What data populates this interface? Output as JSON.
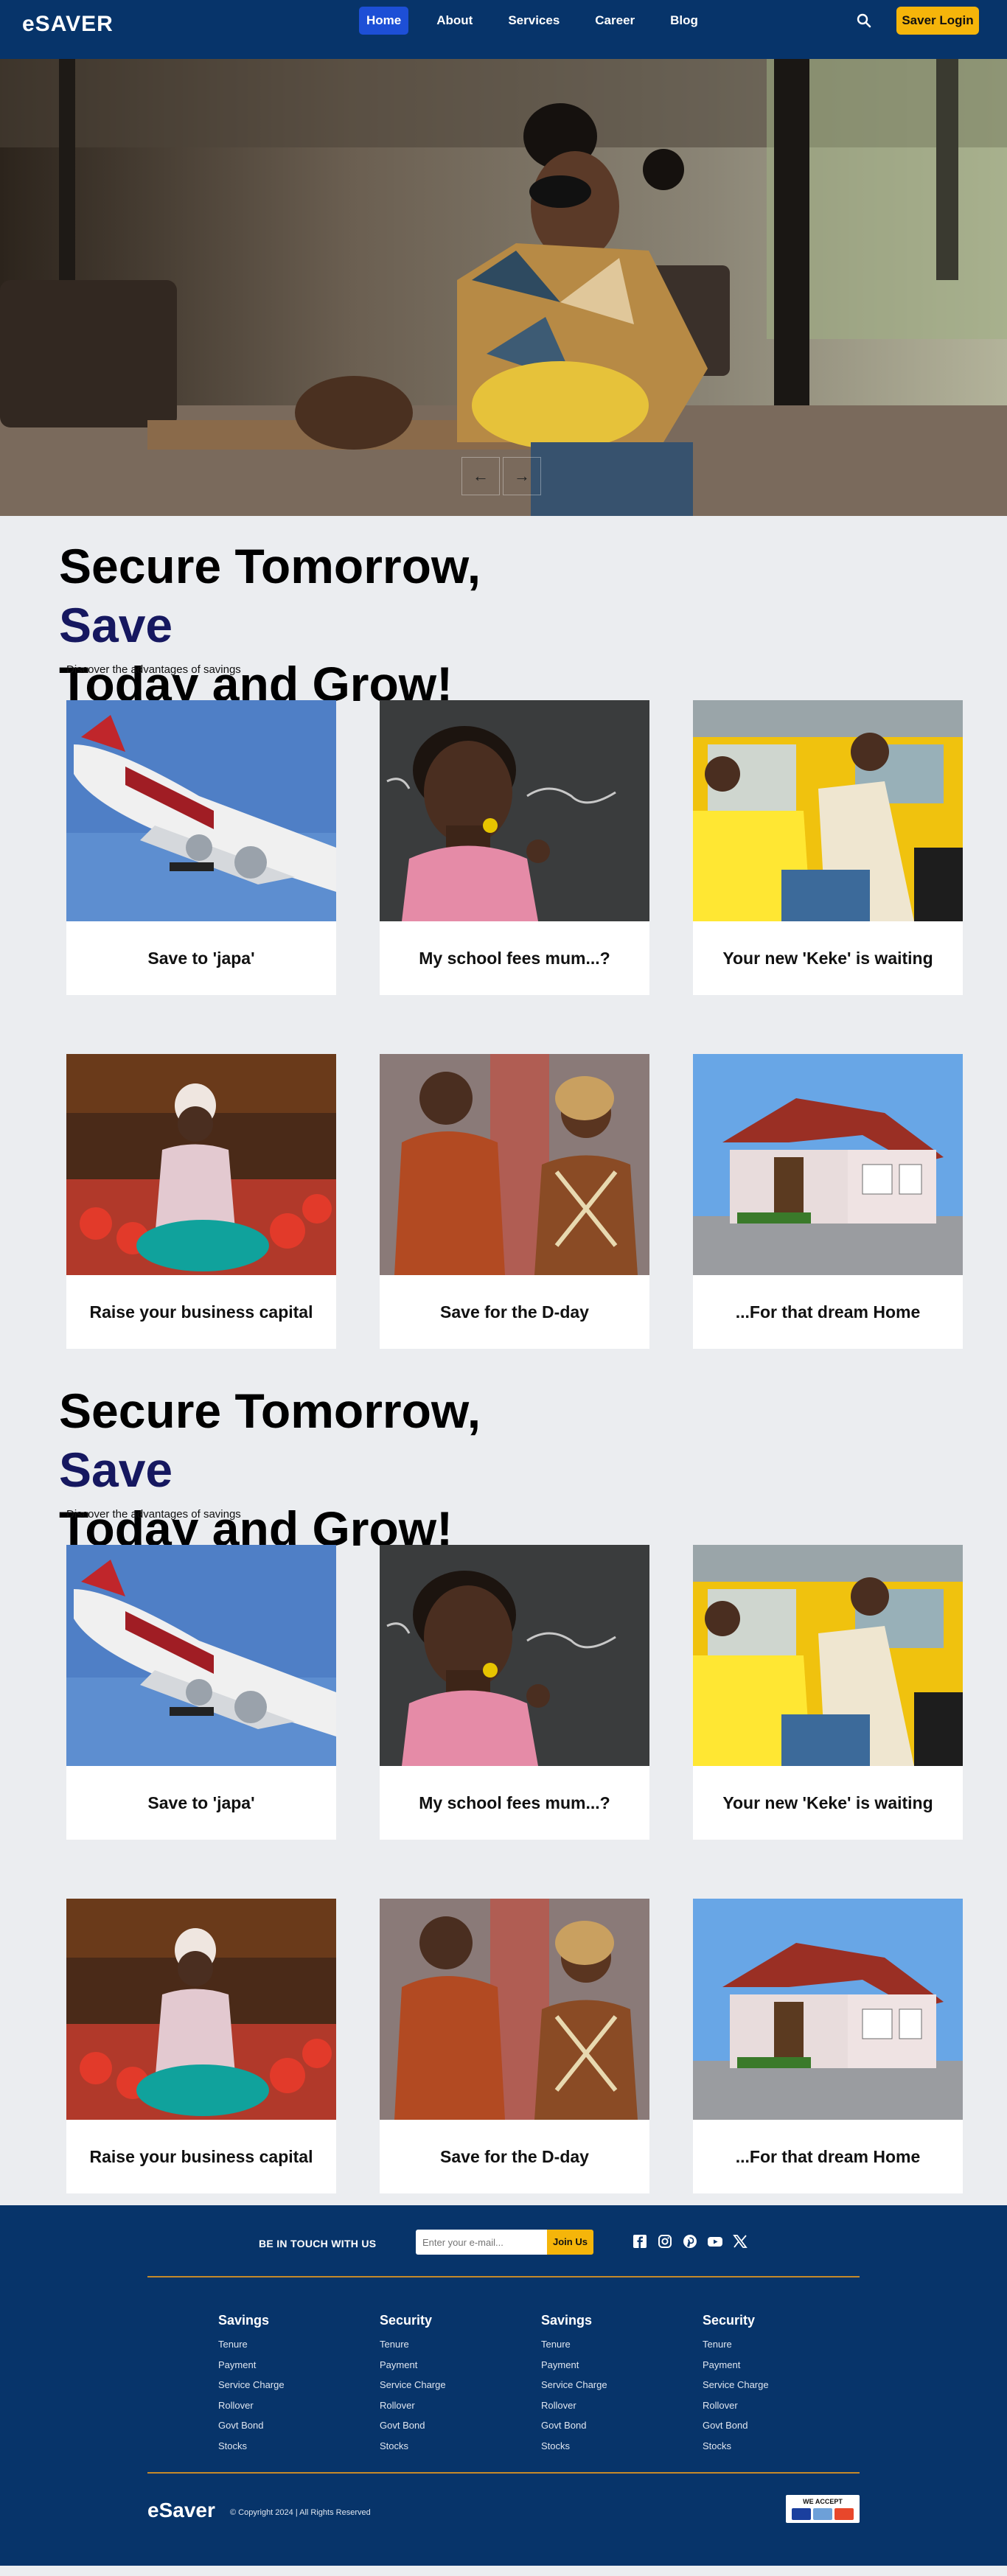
{
  "nav": {
    "logo": "eSAVER",
    "items": [
      {
        "label": "Home",
        "active": true
      },
      {
        "label": "About",
        "active": false
      },
      {
        "label": "Services",
        "active": false
      },
      {
        "label": "Career",
        "active": false
      },
      {
        "label": "Blog",
        "active": false
      }
    ],
    "search_icon": "search-icon",
    "login_label": "Saver Login"
  },
  "hero": {
    "prev_icon": "arrow-left-icon",
    "next_icon": "arrow-right-icon",
    "prev_glyph": "←",
    "next_glyph": "→"
  },
  "sections": [
    {
      "title_start": "Secure Tomorrow, ",
      "title_accent": "Save",
      "title_end": "Today and Grow!",
      "subtitle": "Discover the advantages of savings",
      "cards": [
        {
          "caption": "Save to 'japa'",
          "image": "airplane"
        },
        {
          "caption": "My school fees mum...?",
          "image": "schoolgirl"
        },
        {
          "caption": "Your new 'Keke' is waiting",
          "image": "keke"
        },
        {
          "caption": "Raise your business capital",
          "image": "market"
        },
        {
          "caption": "Save for the D-day",
          "image": "wedding"
        },
        {
          "caption": "...For that dream Home",
          "image": "house"
        }
      ]
    },
    {
      "title_start": "Secure Tomorrow, ",
      "title_accent": "Save",
      "title_end": "Today and Grow!",
      "subtitle": "Discover the advantages of savings",
      "cards": [
        {
          "caption": "Save to 'japa'",
          "image": "airplane"
        },
        {
          "caption": "My school fees mum...?",
          "image": "schoolgirl"
        },
        {
          "caption": "Your new 'Keke' is waiting",
          "image": "keke"
        },
        {
          "caption": "Raise your business capital",
          "image": "market"
        },
        {
          "caption": "Save for the D-day",
          "image": "wedding"
        },
        {
          "caption": "...For that dream Home",
          "image": "house"
        }
      ]
    }
  ],
  "footer": {
    "touch_title": "BE IN TOUCH WITH US",
    "email_placeholder": "Enter your e-mail...",
    "join_label": "Join Us",
    "socials": [
      "facebook-icon",
      "instagram-icon",
      "pinterest-icon",
      "youtube-icon",
      "x-icon"
    ],
    "columns": [
      {
        "heading": "Savings",
        "links": [
          "Tenure",
          "Payment",
          "Service Charge",
          "Rollover",
          "Govt Bond",
          "Stocks"
        ]
      },
      {
        "heading": "Security",
        "links": [
          "Tenure",
          "Payment",
          "Service Charge",
          "Rollover",
          "Govt Bond",
          "Stocks"
        ]
      },
      {
        "heading": "Savings",
        "links": [
          "Tenure",
          "Payment",
          "Service Charge",
          "Rollover",
          "Govt Bond",
          "Stocks"
        ]
      },
      {
        "heading": "Security",
        "links": [
          "Tenure",
          "Payment",
          "Service Charge",
          "Rollover",
          "Govt Bond",
          "Stocks"
        ]
      }
    ],
    "brand": "eSaver",
    "copyright": "© Copyright 2024 | All Rights Reserved",
    "accept_label": "WE ACCEPT"
  },
  "colors": {
    "nav_bg": "#07346a",
    "accent_blue": "#1d4fd6",
    "gold": "#f5b50a",
    "title_accent": "#161860",
    "page_bg": "#ebedf0"
  }
}
